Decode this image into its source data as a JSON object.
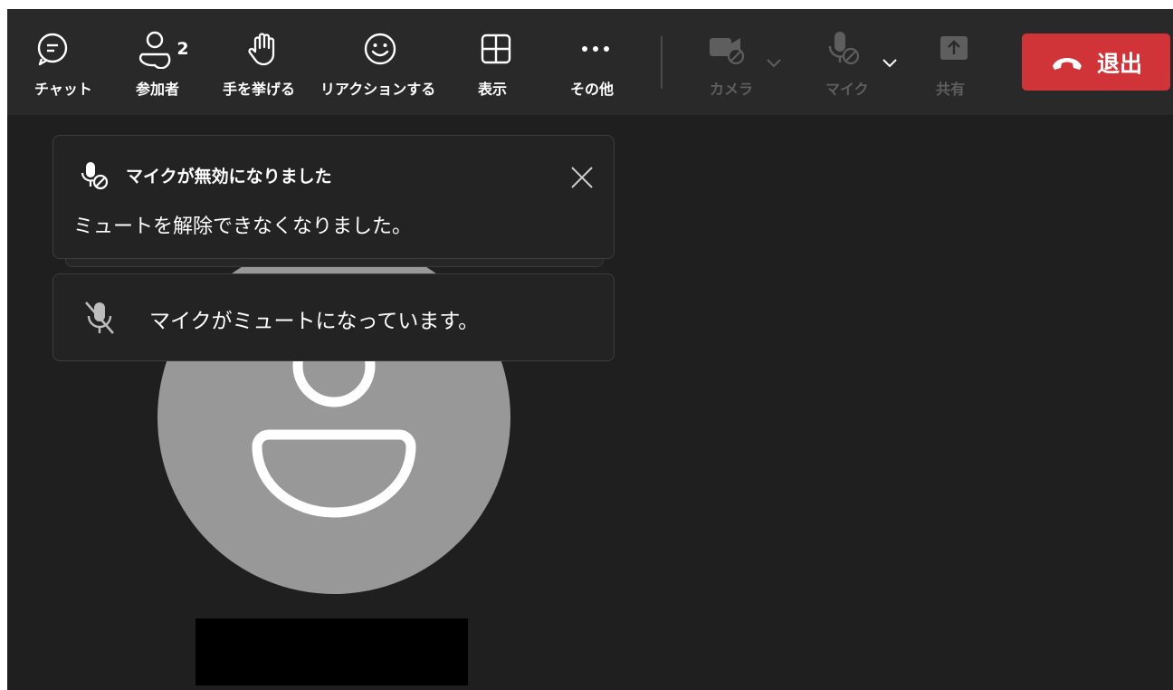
{
  "toolbar": {
    "chat_label": "チャット",
    "participants_label": "参加者",
    "participants_count": "2",
    "raise_hand_label": "手を挙げる",
    "react_label": "リアクションする",
    "view_label": "表示",
    "more_label": "その他",
    "camera_label": "カメラ",
    "mic_label": "マイク",
    "share_label": "共有",
    "leave_label": "退出"
  },
  "notifications": {
    "mic_disabled_title": "マイクが無効になりました",
    "mic_disabled_body": "ミュートを解除できなくなりました。",
    "muted_text": "マイクがミュートになっています。"
  },
  "colors": {
    "toolbar_bg": "#292929",
    "stage_bg": "#1f1f1f",
    "leave_button": "#d13438",
    "disabled_label": "#5e5e5e",
    "avatar_bg": "#989898"
  },
  "icons": [
    "chat-icon",
    "participants-icon",
    "raise-hand-icon",
    "react-icon",
    "view-icon",
    "more-icon",
    "camera-off-icon",
    "mic-off-icon",
    "share-icon",
    "hang-up-icon",
    "mic-disabled-icon",
    "mic-muted-icon",
    "close-icon",
    "person-icon"
  ]
}
